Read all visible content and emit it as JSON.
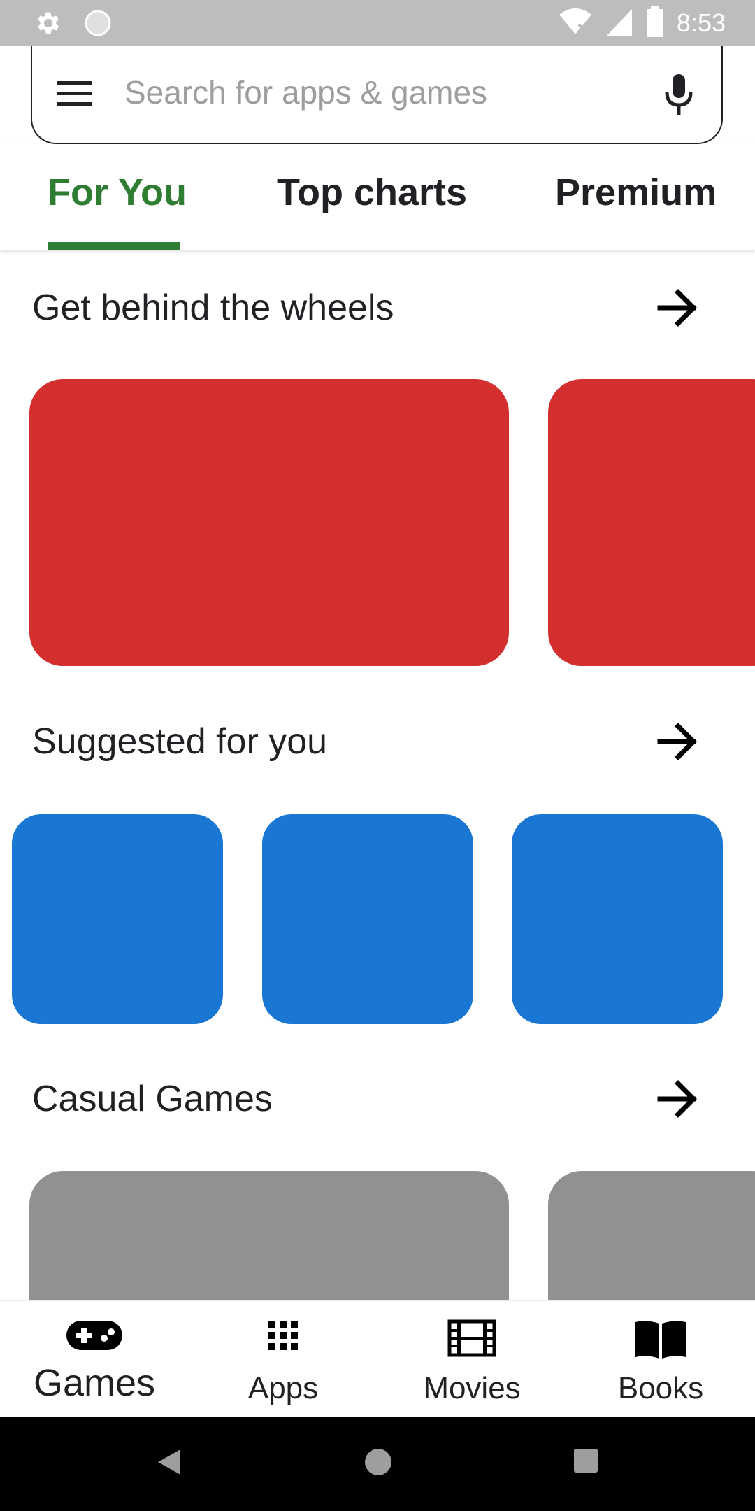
{
  "status_bar": {
    "time": "8:53",
    "icons": [
      "settings-icon",
      "circle-icon",
      "wifi-icon",
      "signal-icon",
      "battery-icon"
    ]
  },
  "search": {
    "placeholder": "Search for apps & games",
    "icons": [
      "menu-icon",
      "mic-icon"
    ]
  },
  "tabs": [
    {
      "label": "For You",
      "active": true
    },
    {
      "label": "Top charts",
      "active": false
    },
    {
      "label": "Premium",
      "active": false
    }
  ],
  "sections": [
    {
      "title": "Get behind the wheels",
      "card_color": "#d32f2f"
    },
    {
      "title": "Suggested for you",
      "card_color": "#1976d2"
    },
    {
      "title": "Casual Games",
      "card_color": "#919191"
    }
  ],
  "bottom_nav": [
    {
      "label": "Games",
      "icon": "gamepad-icon",
      "active": true
    },
    {
      "label": "Apps",
      "icon": "apps-grid-icon",
      "active": false
    },
    {
      "label": "Movies",
      "icon": "film-icon",
      "active": false
    },
    {
      "label": "Books",
      "icon": "book-icon",
      "active": false
    }
  ],
  "system_nav": [
    "back-icon",
    "home-icon",
    "recents-icon"
  ],
  "colors": {
    "accent": "#2e7d32",
    "status_bar": "#bdbdbd",
    "red_card": "#d32f2f",
    "blue_card": "#1976d2",
    "gray_card": "#919191"
  }
}
